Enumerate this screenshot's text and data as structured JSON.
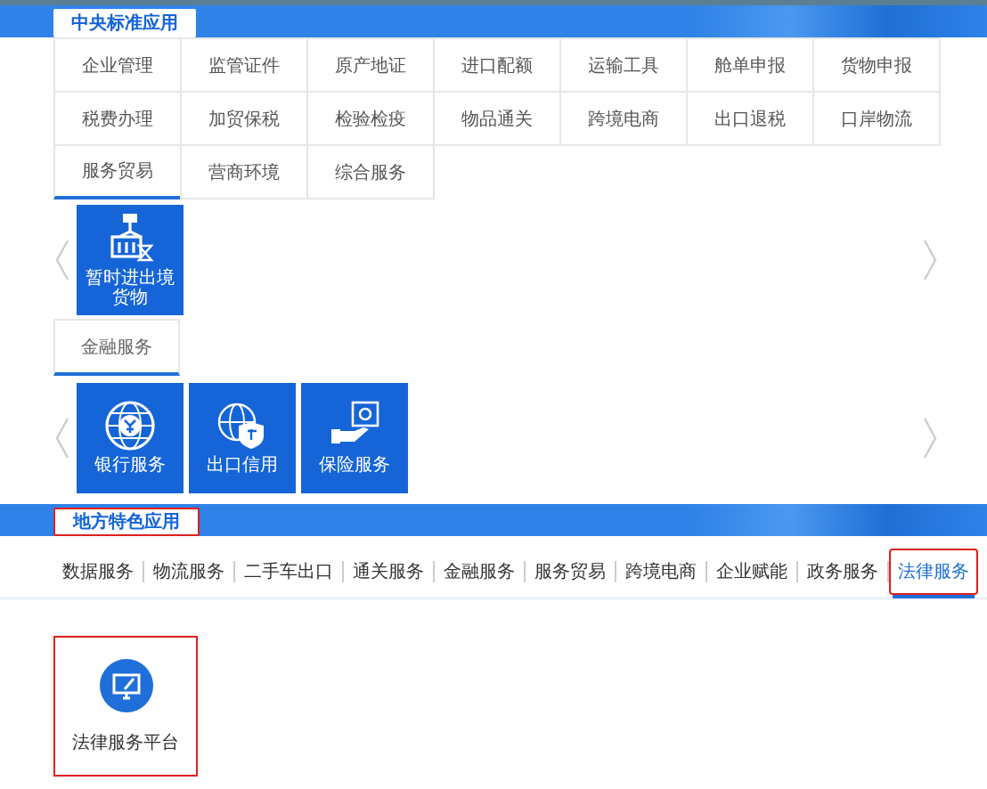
{
  "central": {
    "title": "中央标准应用",
    "highlighted": false,
    "categories": [
      {
        "label": "企业管理",
        "selected": false
      },
      {
        "label": "监管证件",
        "selected": false
      },
      {
        "label": "原产地证",
        "selected": false
      },
      {
        "label": "进口配额",
        "selected": false
      },
      {
        "label": "运输工具",
        "selected": false
      },
      {
        "label": "舱单申报",
        "selected": false
      },
      {
        "label": "货物申报",
        "selected": false
      },
      {
        "label": "税费办理",
        "selected": false
      },
      {
        "label": "加贸保税",
        "selected": false
      },
      {
        "label": "检验检疫",
        "selected": false
      },
      {
        "label": "物品通关",
        "selected": false
      },
      {
        "label": "跨境电商",
        "selected": false
      },
      {
        "label": "出口退税",
        "selected": false
      },
      {
        "label": "口岸物流",
        "selected": false
      },
      {
        "label": "服务贸易",
        "selected": true
      },
      {
        "label": "营商环境",
        "selected": false
      },
      {
        "label": "综合服务",
        "selected": false
      }
    ],
    "panels": [
      {
        "tiles": [
          {
            "label": "暂时进出境货物",
            "kind": "crane"
          }
        ]
      },
      {
        "subtab": {
          "label": "金融服务",
          "selected": true
        },
        "tiles": [
          {
            "label": "银行服务",
            "kind": "globe-coin"
          },
          {
            "label": "出口信用",
            "kind": "globe-shield"
          },
          {
            "label": "保险服务",
            "kind": "hand-safe"
          }
        ]
      }
    ]
  },
  "local": {
    "title": "地方特色应用",
    "highlighted": true,
    "tabs": [
      {
        "label": "数据服务",
        "selected": false,
        "highlighted": false
      },
      {
        "label": "物流服务",
        "selected": false,
        "highlighted": false
      },
      {
        "label": "二手车出口",
        "selected": false,
        "highlighted": false
      },
      {
        "label": "通关服务",
        "selected": false,
        "highlighted": false
      },
      {
        "label": "金融服务",
        "selected": false,
        "highlighted": false
      },
      {
        "label": "服务贸易",
        "selected": false,
        "highlighted": false
      },
      {
        "label": "跨境电商",
        "selected": false,
        "highlighted": false
      },
      {
        "label": "企业赋能",
        "selected": false,
        "highlighted": false
      },
      {
        "label": "政务服务",
        "selected": false,
        "highlighted": false
      },
      {
        "label": "法律服务",
        "selected": true,
        "highlighted": true
      }
    ],
    "cards": [
      {
        "label": "法律服务平台",
        "highlighted": true
      }
    ]
  }
}
